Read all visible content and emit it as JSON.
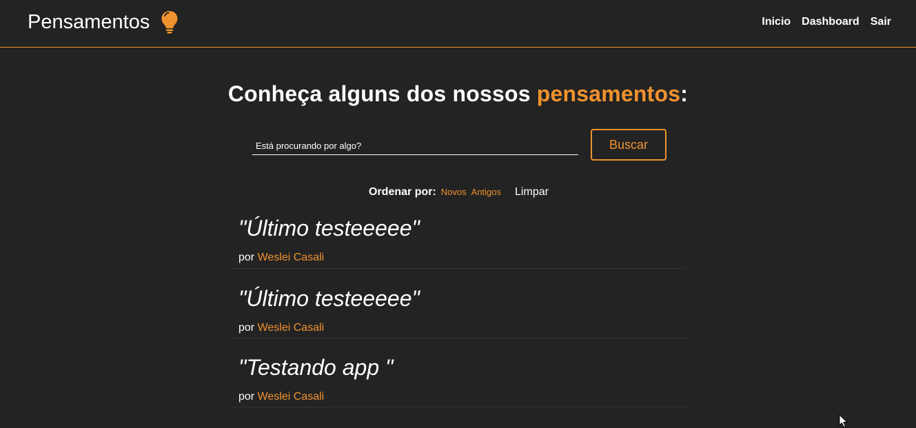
{
  "header": {
    "brand": "Pensamentos",
    "brand_icon": "lightbulb-icon",
    "nav": [
      {
        "label": "Inicio"
      },
      {
        "label": "Dashboard"
      },
      {
        "label": "Sair"
      }
    ]
  },
  "hero": {
    "title_start": "Conheça alguns dos nossos ",
    "title_accent": "pensamentos",
    "title_end": ":"
  },
  "search": {
    "placeholder": "Está procurando por algo?",
    "button_label": "Buscar"
  },
  "order": {
    "label": "Ordenar por:",
    "newest": "Novos",
    "oldest": "Antigos",
    "clear": "Limpar"
  },
  "thoughts": [
    {
      "text": "\"Último testeeeee\"",
      "by": "por",
      "author": "Weslei Casali"
    },
    {
      "text": "\"Último testeeeee\"",
      "by": "por",
      "author": "Weslei Casali"
    },
    {
      "text": "\"Testando app \"",
      "by": "por",
      "author": "Weslei Casali"
    }
  ],
  "colors": {
    "background": "#232323",
    "accent": "#f0922e",
    "text": "#ffffff"
  }
}
